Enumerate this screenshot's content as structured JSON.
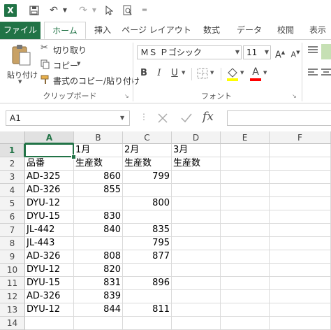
{
  "qat": {
    "app_icon": "X",
    "more": "="
  },
  "tabs": [
    "ファイル",
    "ホーム",
    "挿入",
    "ページ レイアウト",
    "数式",
    "データ",
    "校閲",
    "表示"
  ],
  "ribbon": {
    "paste_label": "貼り付け",
    "cut_label": "切り取り",
    "copy_label": "コピー",
    "format_painter_label": "書式のコピー/貼り付け",
    "clipboard_group": "クリップボード",
    "font_name": "ＭＳ Ｐゴシック",
    "font_size": "11",
    "font_group": "フォント",
    "bold": "B",
    "italic": "I",
    "underline": "U",
    "font_color_letter": "A",
    "font_color": "#ff0000",
    "grow_font": "A",
    "shrink_font": "A"
  },
  "formula_bar": {
    "name_box": "A1",
    "fx": "fx",
    "value": ""
  },
  "grid": {
    "accent": "#217346",
    "columns": [
      "A",
      "B",
      "C",
      "D",
      "E",
      "F"
    ],
    "rows": [
      "1",
      "2",
      "3",
      "4",
      "5",
      "6",
      "7",
      "8",
      "9",
      "10",
      "11",
      "12",
      "13",
      "14"
    ],
    "cells": [
      [
        "",
        "1月",
        "2月",
        "3月",
        "",
        ""
      ],
      [
        "品番",
        "生産数",
        "生産数",
        "生産数",
        "",
        ""
      ],
      [
        "AD-325",
        "860",
        "799",
        "",
        "",
        ""
      ],
      [
        "AD-326",
        "855",
        "",
        "",
        "",
        ""
      ],
      [
        "DYU-12",
        "",
        "800",
        "",
        "",
        ""
      ],
      [
        "DYU-15",
        "830",
        "",
        "",
        "",
        ""
      ],
      [
        "JL-442",
        "840",
        "835",
        "",
        "",
        ""
      ],
      [
        "JL-443",
        "",
        "795",
        "",
        "",
        ""
      ],
      [
        "AD-326",
        "808",
        "877",
        "",
        "",
        ""
      ],
      [
        "DYU-12",
        "820",
        "",
        "",
        "",
        ""
      ],
      [
        "DYU-15",
        "831",
        "896",
        "",
        "",
        ""
      ],
      [
        "AD-326",
        "839",
        "",
        "",
        "",
        ""
      ],
      [
        "DYU-12",
        "844",
        "811",
        "",
        "",
        ""
      ],
      [
        "",
        "",
        "",
        "",
        "",
        ""
      ]
    ]
  }
}
